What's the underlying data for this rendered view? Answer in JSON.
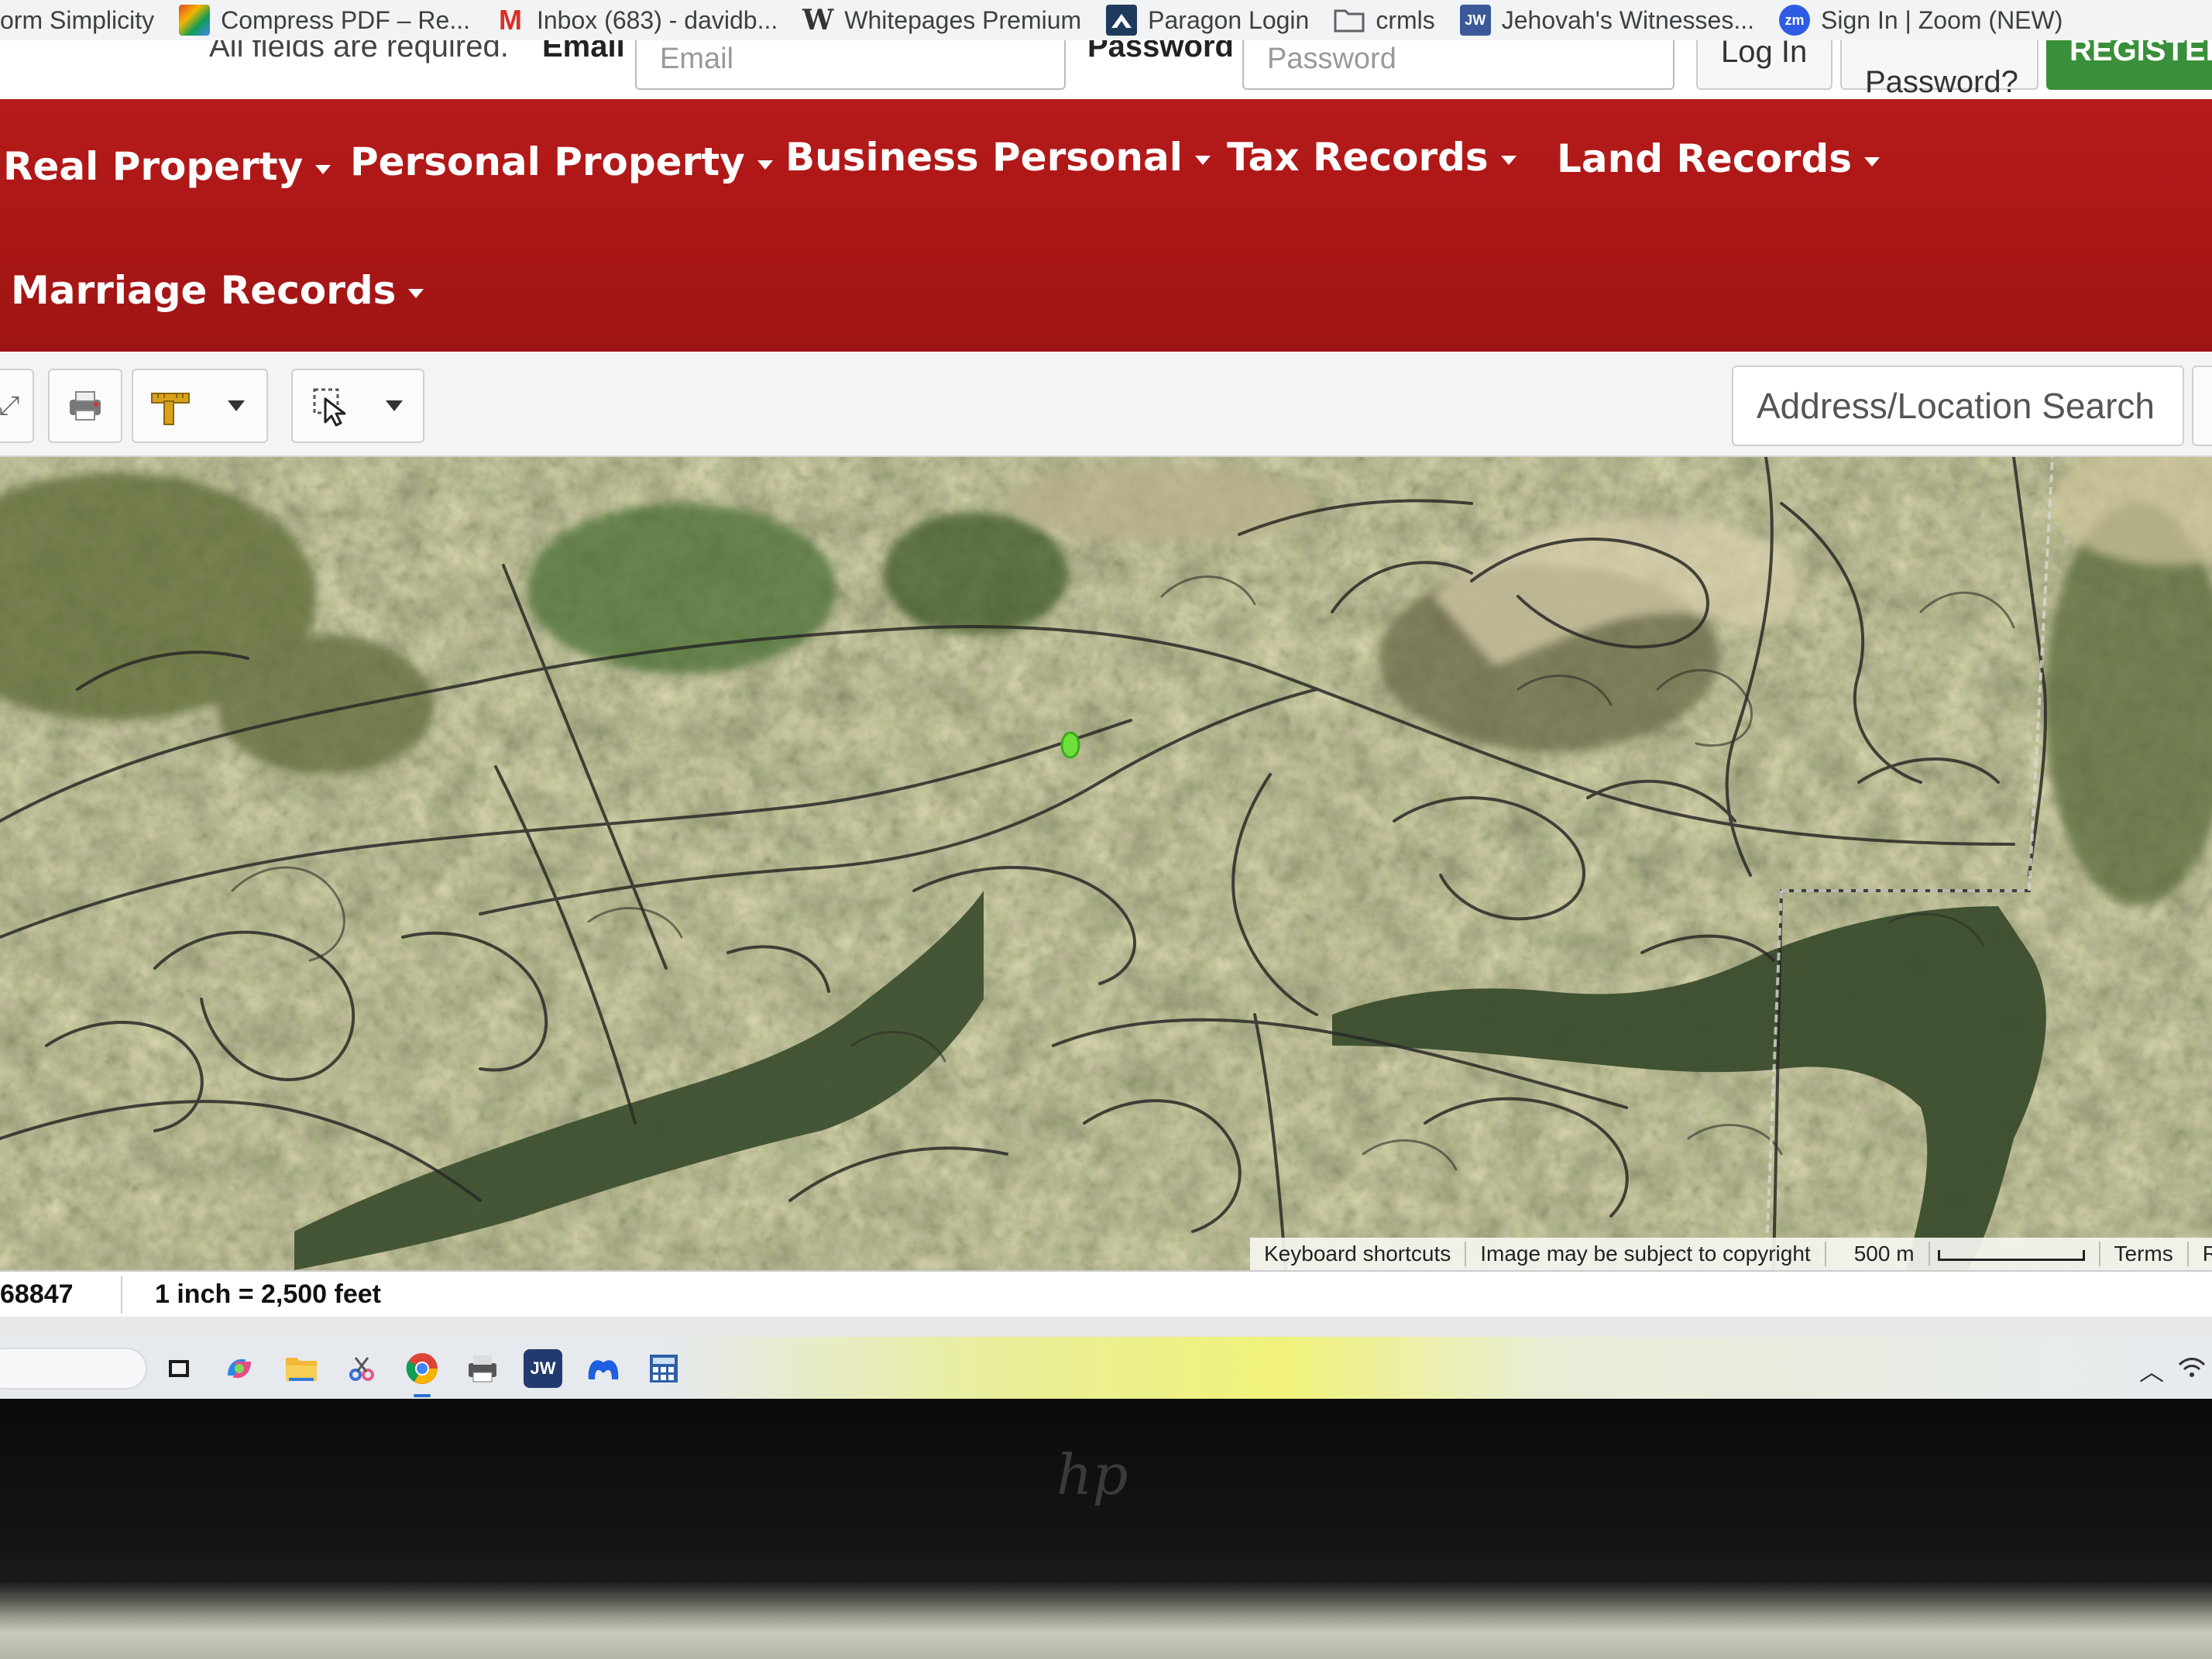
{
  "bookmarks": [
    {
      "label": "orm Simplicity",
      "icon": "",
      "color": ""
    },
    {
      "label": "Compress PDF – Re...",
      "icon": "colorful-squares-icon",
      "color": "#e0442c"
    },
    {
      "label": "Inbox (683) - davidb...",
      "icon": "gmail-icon",
      "color": "#d93025"
    },
    {
      "label": "Whitepages Premium",
      "icon": "whitepages-icon",
      "color": "#333333"
    },
    {
      "label": "Paragon Login",
      "icon": "paragon-icon",
      "color": "#1f3a5c"
    },
    {
      "label": "crmls",
      "icon": "folder-icon",
      "color": "#5f6368"
    },
    {
      "label": "Jehovah's Witnesses...",
      "icon": "jw-icon",
      "color": "#3b5998"
    },
    {
      "label": "Sign In | Zoom (NEW)",
      "icon": "zoom-icon",
      "color": "#2d5be3"
    }
  ],
  "bookmark_icon_text": {
    "paragon": "",
    "jw": "JW",
    "zoom": "zm",
    "whitepages": "W",
    "gmail": "M"
  },
  "login": {
    "instruction": "All fields are required.",
    "email_label": "Email",
    "email_placeholder": "Email",
    "password_label": "Password",
    "password_placeholder": "Password",
    "login_button": "Log In",
    "forgot_button": "Password?",
    "register_button": "REGISTER"
  },
  "nav": {
    "items": [
      "Real Property",
      "Personal Property",
      "Business Personal",
      "Tax Records",
      "Land Records",
      "Marriage Records"
    ]
  },
  "toolbar": {
    "search_placeholder": "Address/Location Search"
  },
  "map": {
    "attribution": [
      "Keyboard shortcuts",
      "Image may be subject to copyright"
    ],
    "scale_label": "500 m",
    "links": [
      "Terms",
      "Re"
    ]
  },
  "status": {
    "coordinate": "68847",
    "scale": "1 inch = 2,500 feet"
  },
  "taskbar": {
    "apps": [
      "task-view-icon",
      "copilot-icon",
      "file-explorer-icon",
      "snipping-tool-icon",
      "chrome-icon",
      "printer-app-icon",
      "jw-library-icon",
      "malwarebytes-icon",
      "calculator-icon"
    ],
    "jw_text": "JW"
  },
  "device": {
    "logo": "hp"
  },
  "colors": {
    "nav_red": "#a61616",
    "register_green": "#3a8f3a",
    "marker_green": "#6fe03a"
  }
}
